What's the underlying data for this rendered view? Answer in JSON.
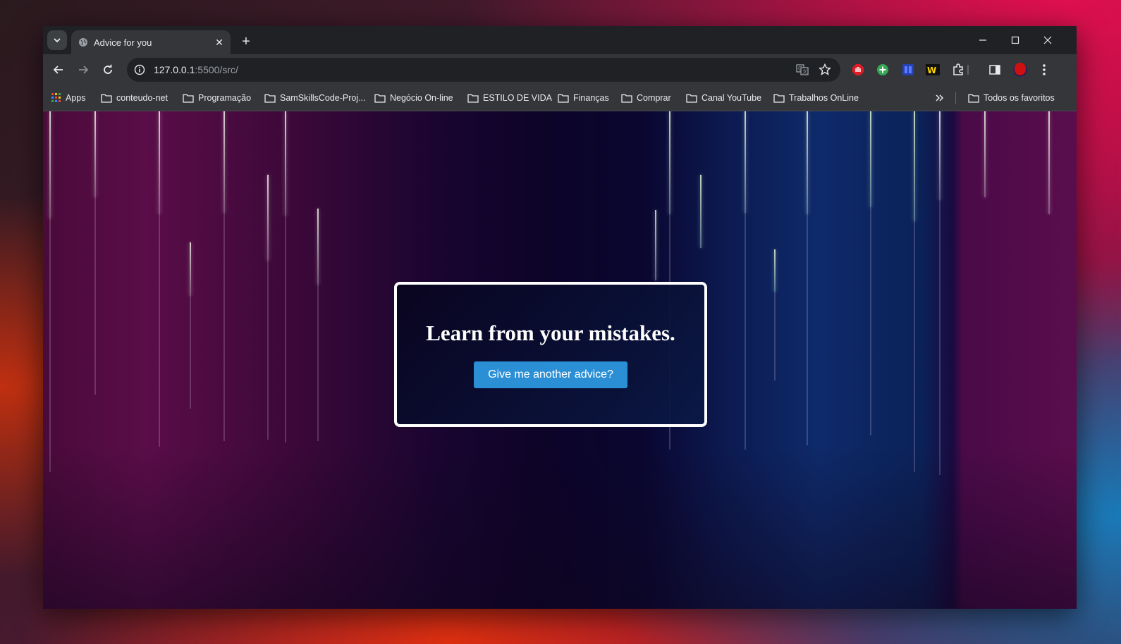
{
  "browser": {
    "tab": {
      "title": "Advice for you"
    },
    "url": {
      "host": "127.0.0.1",
      "rest": ":5500/src/"
    },
    "bookmarks": {
      "apps": "Apps",
      "items": [
        "conteudo-net",
        "Programação",
        "SamSkillsCode-Proj...",
        "Negócio On-line",
        "ESTILO DE VIDA",
        "Finanças",
        "Comprar",
        "Canal YouTube",
        "Trabalhos OnLine"
      ],
      "all": "Todos os favoritos"
    },
    "icons": [
      "tab-search-icon",
      "globe-icon",
      "close-tab-icon",
      "new-tab-icon",
      "minimize-icon",
      "maximize-icon",
      "close-window-icon",
      "back-icon",
      "forward-icon",
      "reload-icon",
      "site-info-icon",
      "translate-icon",
      "bookmark-star-icon",
      "extensions-icon",
      "side-panel-icon",
      "profile-avatar",
      "menu-icon"
    ]
  },
  "page": {
    "advice": "Learn from your mistakes.",
    "button_label": "Give me another advice?"
  },
  "colors": {
    "button": "#2b8fd6",
    "card_border": "#ffffff"
  }
}
